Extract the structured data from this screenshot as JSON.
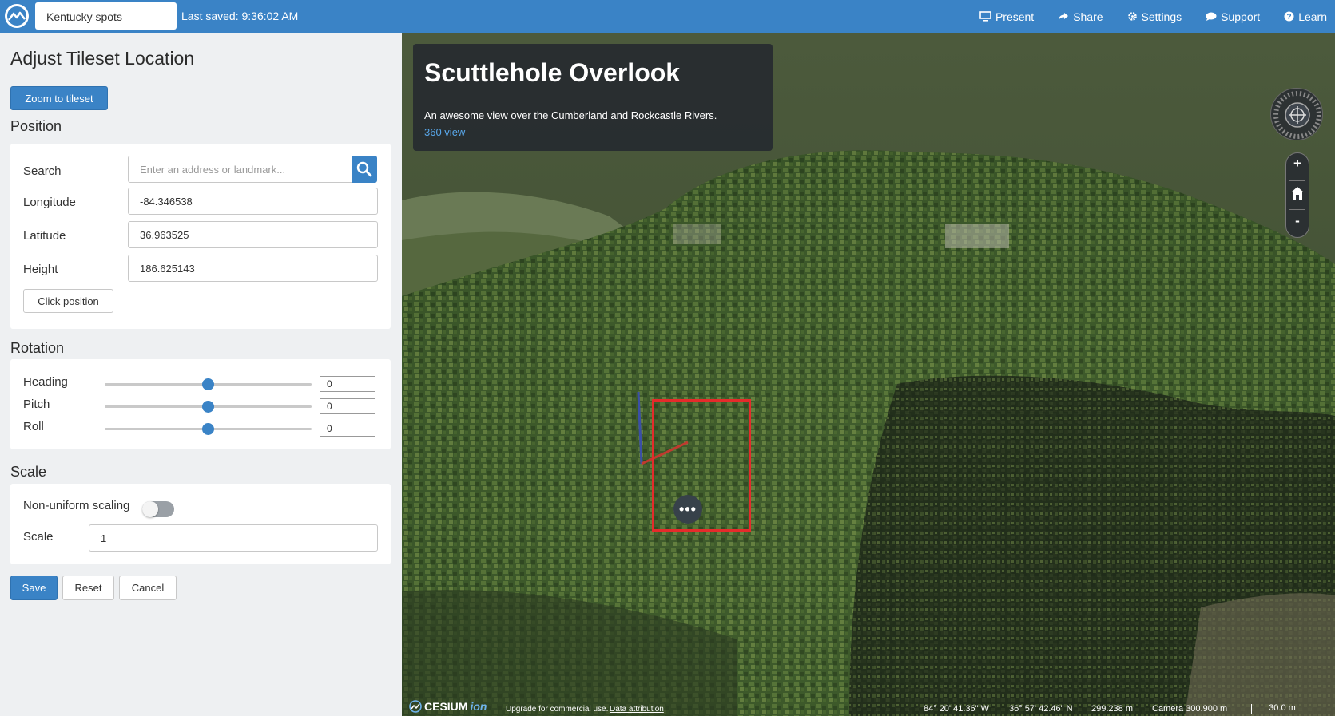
{
  "topbar": {
    "project_name": "Kentucky spots",
    "last_saved": "Last saved: 9:36:02 AM",
    "nav": [
      {
        "label": "Present",
        "icon": "monitor-icon"
      },
      {
        "label": "Share",
        "icon": "share-icon"
      },
      {
        "label": "Settings",
        "icon": "gear-icon"
      },
      {
        "label": "Support",
        "icon": "chat-bubble-icon"
      },
      {
        "label": "Learn",
        "icon": "question-circle-icon"
      }
    ]
  },
  "panel": {
    "title": "Adjust Tileset Location",
    "zoom_button": "Zoom to tileset",
    "position": {
      "section_title": "Position",
      "search_label": "Search",
      "search_placeholder": "Enter an address or landmark...",
      "longitude_label": "Longitude",
      "longitude_value": "-84.346538",
      "latitude_label": "Latitude",
      "latitude_value": "36.963525",
      "height_label": "Height",
      "height_value": "186.625143",
      "click_position_button": "Click position"
    },
    "rotation": {
      "section_title": "Rotation",
      "sliders": [
        {
          "label": "Heading",
          "value": "0",
          "level": 0.5
        },
        {
          "label": "Pitch",
          "value": "0",
          "level": 0.5
        },
        {
          "label": "Roll",
          "value": "0",
          "level": 0.5
        }
      ]
    },
    "scale": {
      "section_title": "Scale",
      "nonuniform_label": "Non-uniform scaling",
      "nonuniform_enabled": false,
      "scale_label": "Scale",
      "scale_value": "1"
    },
    "actions": {
      "save": "Save",
      "reset": "Reset",
      "cancel": "Cancel"
    }
  },
  "map": {
    "story": {
      "title": "Scuttlehole Overlook",
      "description": "An awesome view over the Cumberland and Rockcastle Rivers.",
      "link": "360 view"
    },
    "zoom_in": "+",
    "zoom_out": "-",
    "footer": {
      "logo_text": "CESIUM",
      "logo_ion": "ion",
      "upgrade": "Upgrade for commercial use.",
      "attribution": "Data attribution",
      "longitude": "84° 20' 41.36\" W",
      "latitude": "36° 57' 42.46\" N",
      "elevation": "299.238 m",
      "camera": "Camera 300.900 m",
      "scale": "30.0 m"
    }
  },
  "colors": {
    "accent": "#3a83c6",
    "selection_box": "#e52b2b",
    "link": "#58a6e8"
  }
}
